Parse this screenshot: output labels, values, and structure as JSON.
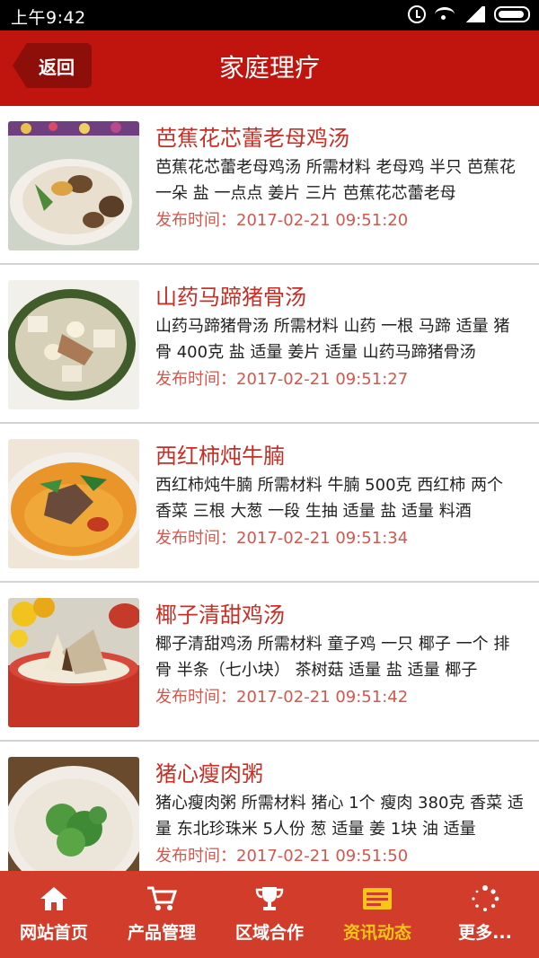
{
  "status_bar": {
    "time": "上午9:42"
  },
  "header": {
    "back_label": "返回",
    "title": "家庭理疗"
  },
  "articles": [
    {
      "title": "芭蕉花芯蕾老母鸡汤",
      "description": "芭蕉花芯蕾老母鸡汤 所需材料 老母鸡 半只 芭蕉花 一朵 盐 一点点 姜片 三片 芭蕉花芯蕾老母",
      "time_label": "发布时间：",
      "time": "2017-02-21 09:51:20",
      "image_icon": "chicken-soup-photo"
    },
    {
      "title": "山药马蹄猪骨汤",
      "description": "山药马蹄猪骨汤 所需材料 山药 一根 马蹄 适量 猪骨 400克 盐 适量 姜片 适量 山药马蹄猪骨汤",
      "time_label": "发布时间：",
      "time": "2017-02-21 09:51:27",
      "image_icon": "pork-bone-soup-photo"
    },
    {
      "title": "西红柿炖牛腩",
      "description": "西红柿炖牛腩 所需材料 牛腩 500克 西红柿 两个 香菜 三根 大葱 一段 生抽 适量 盐 适量 料酒",
      "time_label": "发布时间：",
      "time": "2017-02-21 09:51:34",
      "image_icon": "tomato-beef-photo"
    },
    {
      "title": "椰子清甜鸡汤",
      "description": "椰子清甜鸡汤 所需材料 童子鸡 一只 椰子 一个 排骨 半条（七小块） 茶树菇 适量 盐 适量 椰子",
      "time_label": "发布时间：",
      "time": "2017-02-21 09:51:42",
      "image_icon": "coconut-chicken-soup-photo"
    },
    {
      "title": "猪心瘦肉粥",
      "description": "猪心瘦肉粥 所需材料 猪心 1个 瘦肉 380克 香菜 适量 东北珍珠米 5人份 葱 适量 姜 1块 油 适量",
      "time_label": "发布时间：",
      "time": "2017-02-21 09:51:50",
      "image_icon": "pork-congee-photo"
    }
  ],
  "tabbar": {
    "items": [
      {
        "label": "网站首页",
        "icon": "home-icon"
      },
      {
        "label": "产品管理",
        "icon": "cart-icon"
      },
      {
        "label": "区域合作",
        "icon": "trophy-icon"
      },
      {
        "label": "资讯动态",
        "icon": "news-icon",
        "active": true
      },
      {
        "label": "更多...",
        "icon": "more-icon"
      }
    ],
    "active_color": "#f5c518"
  },
  "colors": {
    "header": "#c0140f",
    "tabbar": "#d23c2a",
    "title_text": "#c52f25"
  }
}
